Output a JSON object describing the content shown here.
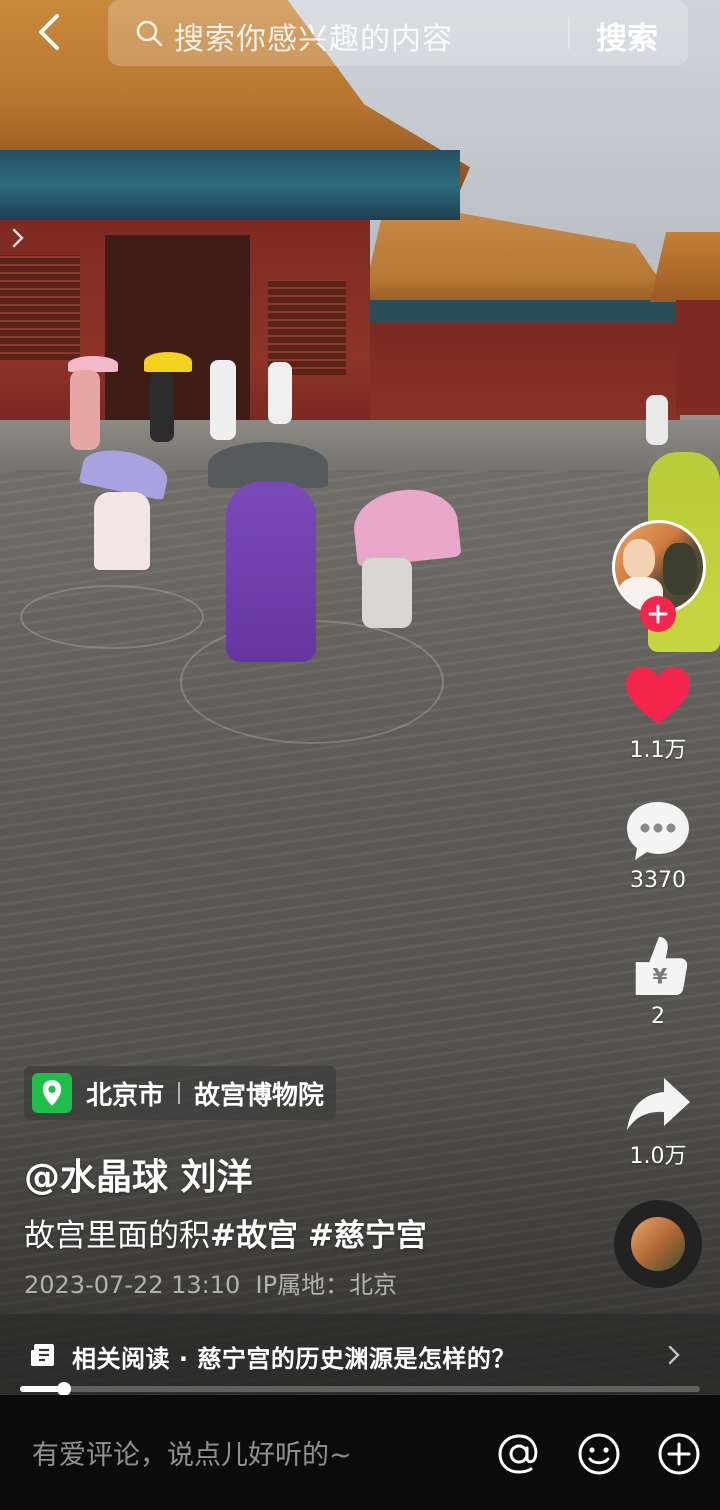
{
  "search": {
    "placeholder": "搜索你感兴趣的内容",
    "button_label": "搜索"
  },
  "actions": {
    "likes": "1.1万",
    "comments": "3370",
    "tips": "2",
    "shares": "1.0万",
    "tip_symbol": "¥"
  },
  "location": {
    "city": "北京市",
    "place": "故宫博物院"
  },
  "post": {
    "author": "@水晶球 刘洋",
    "text": "故宫里面的积",
    "tag1": "#故宫",
    "tag2": "#慈宁宫",
    "date": "2023-07-22 13:10",
    "ip_label": "IP属地：",
    "ip_value": "北京"
  },
  "related": {
    "text": "相关阅读 · 慈宁宫的历史渊源是怎样的？"
  },
  "playback": {
    "progress_fraction": 0.065
  },
  "comment_bar": {
    "placeholder": "有爱评论，说点儿好听的~"
  },
  "colors": {
    "like": "#f5264d",
    "location_icon": "#1fbf4b"
  }
}
